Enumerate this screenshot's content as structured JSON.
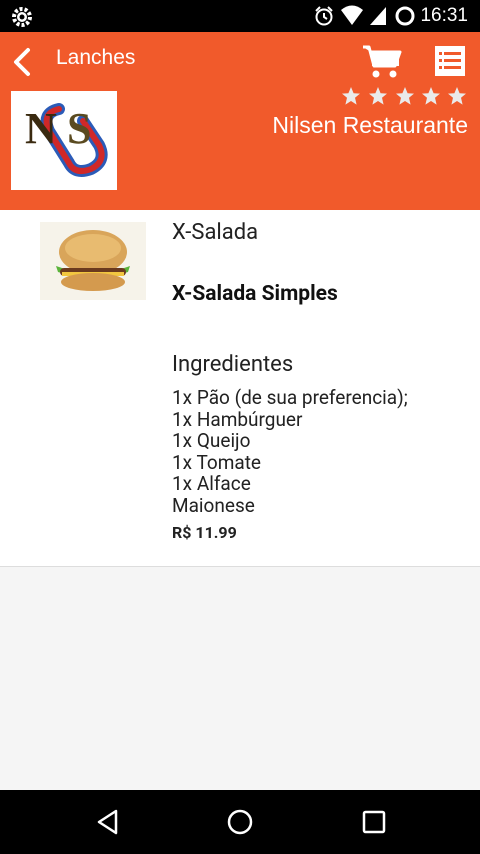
{
  "status": {
    "time": "16:31"
  },
  "header": {
    "title": "Lanches",
    "restaurant": "Nilsen Restaurante",
    "rating": 0,
    "max_rating": 5
  },
  "item": {
    "category": "X-Salada",
    "name": "X-Salada Simples",
    "ingredients_title": "Ingredientes",
    "ingredients": [
      "1x Pão (de sua preferencia);",
      "1x Hambúrguer",
      "1x Queijo",
      "1x Tomate",
      "1x Alface",
      "Maionese"
    ],
    "price": "R$ 11.99"
  },
  "icons": {
    "settings": "gear-icon",
    "alarm": "alarm-icon",
    "wifi": "wifi-icon",
    "signal": "signal-icon",
    "battery": "battery-icon",
    "back": "chevron-left-icon",
    "cart": "cart-icon",
    "list": "list-icon"
  },
  "colors": {
    "header": "#f15a2b",
    "status_bar": "#000000",
    "nav_bar": "#000000"
  }
}
